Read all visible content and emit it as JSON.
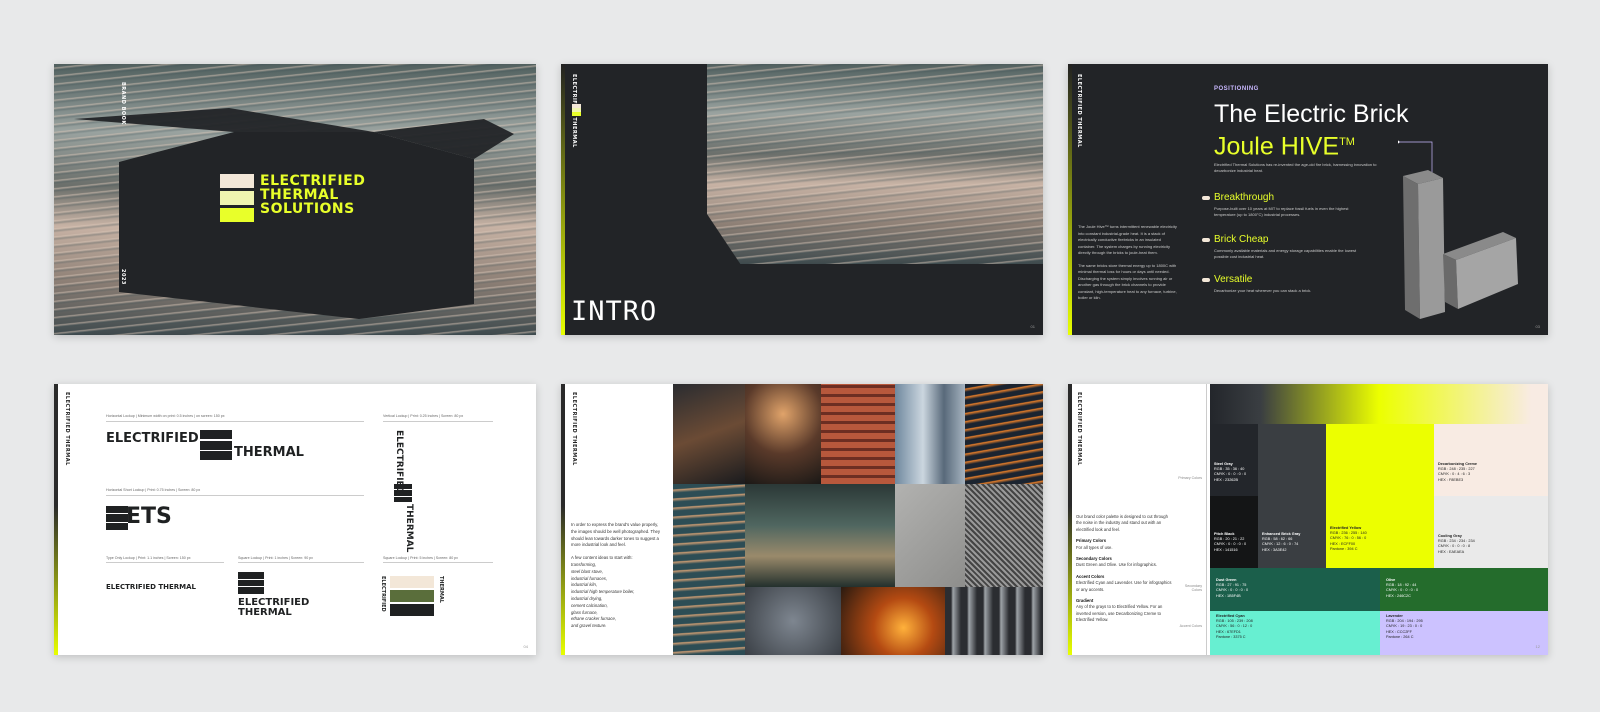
{
  "slide1": {
    "vertical_top": "BRAND BOOK",
    "vertical_bottom": "2023",
    "logo_lines": [
      "ELECTRIFIED",
      "THERMAL",
      "SOLUTIONS"
    ]
  },
  "slide2": {
    "vertical_label": "ELECTRIFIED THERMAL",
    "title": "INTRO",
    "page": "01"
  },
  "slide3": {
    "vertical_label": "ELECTRIFIED THERMAL",
    "kicker": "POSITIONING",
    "headline": "The Electric Brick",
    "subhead": "Joule HIVE",
    "subhead_sup": "TM",
    "intro": "Electrified Thermal Solutions has re-invented the age-old fire brick, harnessing innovation to decarbonize industrial heat.",
    "bullets": [
      {
        "title": "Breakthrough",
        "desc": "Purpose-built over 10 years at MIT to replace fossil fuels in even the highest temperature (up to 1800°C) industrial processes."
      },
      {
        "title": "Brick Cheap",
        "desc": "Commonly available materials and energy storage capabilities enable the lowest possible cost industrial heat."
      },
      {
        "title": "Versatile",
        "desc": "Decarbonize your heat wherever you can stack a brick."
      }
    ],
    "left_paragraphs": [
      "The Joule Hive™ turns intermittent renewable electricity into constant industrial-grade heat. It is a stack of electrically conductive firebricks in an insulated container. The system charges by running electricity directly through the bricks to joule-heat them.",
      "The same bricks store thermal energy up to 1800C with minimal thermal loss for hours or days until needed. Discharging the system simply involves running air or another gas through the brick channels to provide constant, high-temperature heat to any furnace, turbine, boiler or kiln."
    ],
    "page": "03"
  },
  "slide4": {
    "vertical_label": "ELECTRIFIED THERMAL",
    "captions": {
      "horizontal": "Horizontal Lockup | Minimum width on print: 0.5 inches | on screen: 150 px",
      "vertical": "Vertical Lockup | Print: 0.25 inches | Screen: 80 px",
      "horizontal_short": "Horizontal Short Lockup | Print: 0.75 inches | Screen: 80 px",
      "type_only": "Type Only Lockup | Print: 1.1 inches | Screen: 150 px",
      "square": "Square Lockup | Print: 1 inches | Screen: 90 px",
      "square_2": "Square Lockup | Print: 5 inches | Screen: 80 px"
    },
    "word_electrified": "ELECTRIFIED",
    "word_thermal": "THERMAL",
    "short_letters": "ETS",
    "type_only": "ELECTRIFIED THERMAL",
    "page": "04"
  },
  "slide5": {
    "vertical_label": "ELECTRIFIED THERMAL",
    "para1": "In order to express the brand's value properly, the images should be well photographed. They should lean towards darker tones to suggest a more industrial look and feel.",
    "para2_intro": "A few content ideas to start with:",
    "ideas": [
      "transforming,",
      "steel blast stove,",
      "industrial furnaces,",
      "industrial kiln,",
      "industrial high temperature boiler,",
      "industrial drying,",
      "cement calcination,",
      "glass furnace,",
      "ethane cracker furnace,",
      "and gravel texture."
    ]
  },
  "slide6": {
    "vertical_label": "ELECTRIFIED THERMAL",
    "intro": "Our brand color palette is designed to cut through the noise in the industry and stand out with an electrified look and feel.",
    "groups": [
      {
        "title": "Primary Colors",
        "desc": "For all types of use."
      },
      {
        "title": "Secondary Colors",
        "desc": "Dust Green and Olive. Use for infographics."
      },
      {
        "title": "Accent Colors",
        "desc": "Electrified Cyan and Lavender. Use for infographics or any accents."
      },
      {
        "title": "Gradient",
        "desc": "Any of the grays to to Electrified Yellow. For an inverted version, use Decarbonizing Creme to Electrified Yellow."
      }
    ],
    "side_labels": [
      "Primary Colors",
      "Secondary Colors",
      "Accent Colors"
    ],
    "swatches": {
      "steel_gray": {
        "name": "Steel Gray",
        "lines": [
          "RGB : 35 : 36 : 40",
          "CMYK : 0 : 0 : 0 : 0",
          "HEX : 23262B"
        ]
      },
      "pitch_black": {
        "name": "Pitch Black",
        "lines": [
          "RGB : 20 : 21 : 22",
          "CMYK : 0 : 0 : 0 : 0",
          "HEX : 141516"
        ]
      },
      "enhanced_brick": {
        "name": "Enhanced Brick Gray",
        "lines": [
          "RGB : 58 : 62 : 66",
          "CMYK : 12 : 6 : 0 : 74",
          "HEX : 3A3E42"
        ]
      },
      "electrified_yellow": {
        "name": "Electrified Yellow",
        "lines": [
          "RGB : 236 : 255 : 140",
          "CMYK : 76 : 0 : 56 : 0",
          "HEX : ECFF00",
          "Pantone : 394 C"
        ]
      },
      "decarb_creme": {
        "name": "Decarbonizing Creme",
        "lines": [
          "RGB : 248 : 235 : 227",
          "CMYK : 0 : 4 : 6 : 3",
          "HEX : F8EBE3"
        ]
      },
      "cooling_gray": {
        "name": "Cooling Gray",
        "lines": [
          "RGB : 234 : 234 : 234",
          "CMYK : 0 : 0 : 0 : 8",
          "HEX : EAEAEA"
        ]
      },
      "dust_green": {
        "name": "Dust Green",
        "lines": [
          "RGB : 27 : 91 : 75",
          "CMYK : 0 : 0 : 0 : 0",
          "HEX : 1B5F4B"
        ]
      },
      "olive": {
        "name": "Olive",
        "lines": [
          "RGB : 18 : 92 : 44",
          "CMYK : 0 : 0 : 0 : 0",
          "HEX : 246C2C"
        ]
      },
      "electrified_cyan": {
        "name": "Electrified Cyan",
        "lines": [
          "RGB : 105 : 239 : 208",
          "CMYK : 56 : 0 : 12 : 0",
          "HEX : 67EFD1",
          "Pantone : 3375 C"
        ]
      },
      "lavender": {
        "name": "Lavender",
        "lines": [
          "RGB : 204 : 194 : 295",
          "CMYK : 19 : 23 : 0 : 0",
          "HEX : CCC2FF",
          "Pantone : 264 C"
        ]
      }
    },
    "colors": {
      "steel_gray": "#23262B",
      "pitch_black": "#141516",
      "enhanced_brick": "#3A3E42",
      "electrified_yellow": "#ECFF00",
      "decarb_creme": "#F8EBE3",
      "cooling_gray": "#EAEAEA",
      "dust_green": "#1B5F4B",
      "olive": "#246C2C",
      "electrified_cyan": "#67EFD1",
      "lavender": "#CCC2FF"
    },
    "page": "12"
  }
}
